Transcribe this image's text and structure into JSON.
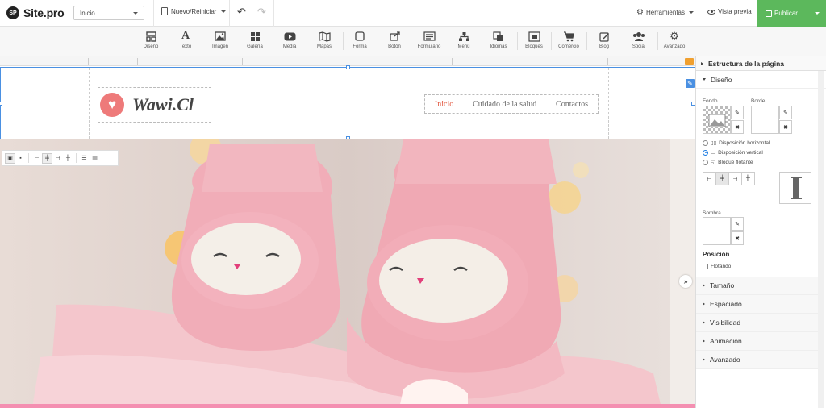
{
  "topbar": {
    "logo_badge": "SP",
    "logo_text": "Site.pro",
    "page_select": "Inicio",
    "new_reset": "Nuevo/Reiniciar",
    "undo": "↶",
    "redo": "↷",
    "tools": "Herramientas",
    "preview": "Vista previa",
    "publish": "Publicar",
    "publish_color": "#5cb85c"
  },
  "toolbar": {
    "items": [
      {
        "label": "Diseño",
        "icon": "layout-icon"
      },
      {
        "label": "Texto",
        "icon": "text-icon"
      },
      {
        "label": "Imagen",
        "icon": "image-icon"
      },
      {
        "label": "Galería",
        "icon": "gallery-icon"
      },
      {
        "label": "Media",
        "icon": "media-icon"
      },
      {
        "label": "Mapas",
        "icon": "map-icon"
      },
      {
        "label": "Forma",
        "icon": "shape-icon"
      },
      {
        "label": "Botón",
        "icon": "button-icon"
      },
      {
        "label": "Formulario",
        "icon": "form-icon"
      },
      {
        "label": "Menú",
        "icon": "menu-icon"
      },
      {
        "label": "Idiomas",
        "icon": "languages-icon"
      },
      {
        "label": "Bloques",
        "icon": "blocks-icon"
      },
      {
        "label": "Comercio",
        "icon": "cart-icon"
      },
      {
        "label": "Blog",
        "icon": "blog-icon"
      },
      {
        "label": "Social",
        "icon": "social-icon"
      },
      {
        "label": "Avanzado",
        "icon": "gears-icon"
      }
    ]
  },
  "site": {
    "brand": "Wawi.Cl",
    "menu": [
      "Inicio",
      "Cuidado de la salud",
      "Contactos"
    ],
    "accent": "#e2553c"
  },
  "panel": {
    "title": "Estructura de la página",
    "design": "Diseño",
    "background_label": "Fondo",
    "border_label": "Borde",
    "layouts": [
      "Disposición horizontal",
      "Disposición vertical",
      "Bloque flotante"
    ],
    "selected_layout": "Disposición vertical",
    "shadow_label": "Sombra",
    "position_title": "Posición",
    "floating": "Flotando",
    "sections": [
      "Tamaño",
      "Espaciado",
      "Visibilidad",
      "Animación",
      "Avanzado"
    ]
  }
}
